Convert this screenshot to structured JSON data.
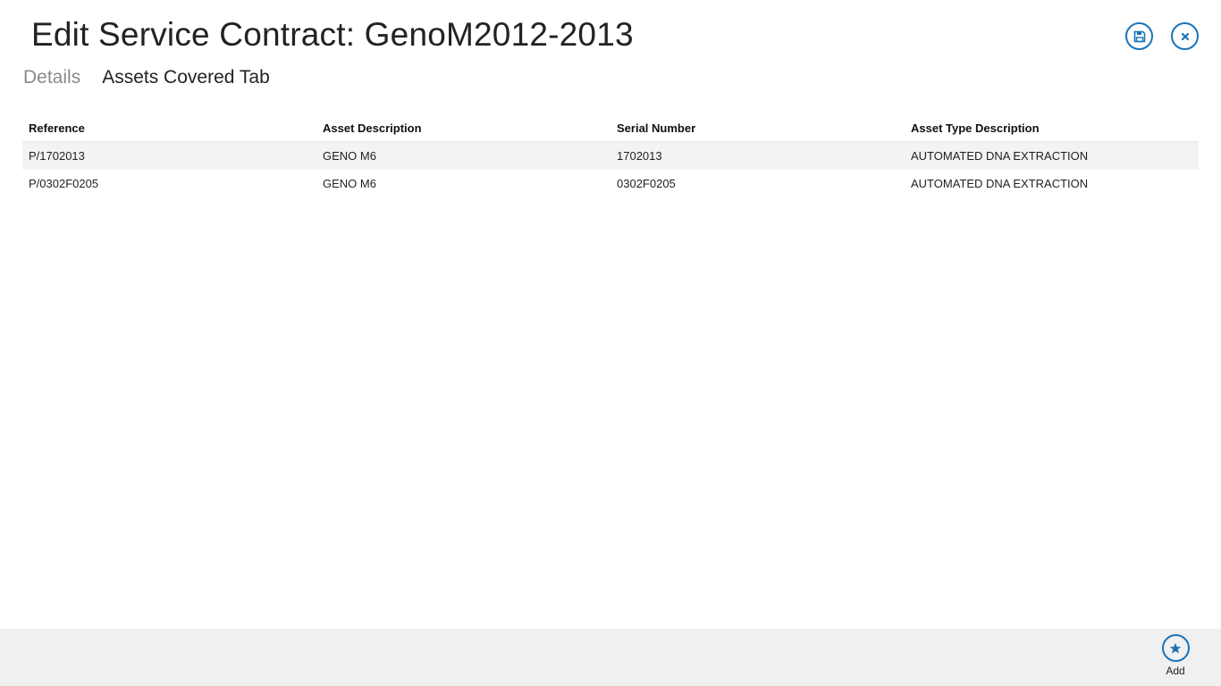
{
  "header": {
    "title": "Edit Service Contract: GenoM2012-2013",
    "icons": {
      "save": "save-icon",
      "close": "close-icon"
    }
  },
  "tabs": [
    {
      "label": "Details",
      "selected": false
    },
    {
      "label": "Assets Covered Tab",
      "selected": true
    }
  ],
  "table": {
    "columns": [
      "Reference",
      "Asset Description",
      "Serial Number",
      "Asset Type Description"
    ],
    "rows": [
      [
        "P/1702013",
        "GENO M6",
        "1702013",
        "AUTOMATED DNA EXTRACTION"
      ],
      [
        "P/0302F0205",
        "GENO M6",
        "0302F0205",
        "AUTOMATED DNA EXTRACTION"
      ]
    ]
  },
  "app_bar": {
    "add_label": "Add",
    "add_icon": "star-icon"
  },
  "colors": {
    "accent": "#1a73b8",
    "app_bar_bg": "#f0f0f0",
    "row_highlight": "#f3f3f3"
  }
}
